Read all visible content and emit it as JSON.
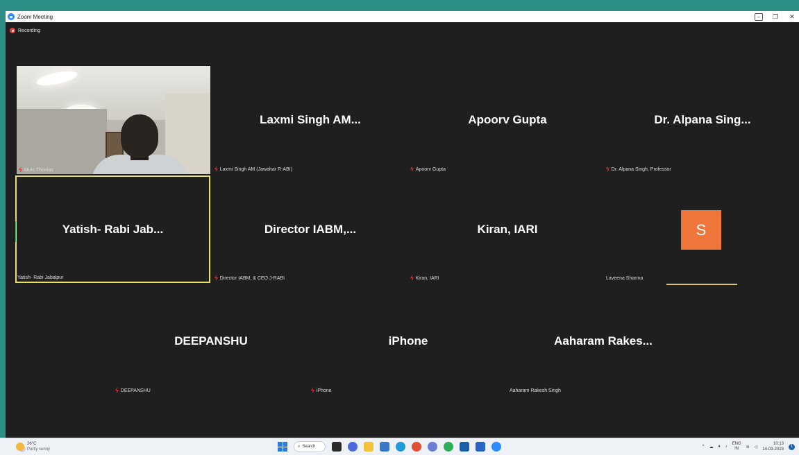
{
  "window": {
    "title": "Zoom Meeting",
    "controls": {
      "minimize": "–",
      "restore": "❐",
      "close": "✕"
    }
  },
  "recording": {
    "label": "Recording",
    "icon": "record-icon",
    "color": "#e0413b"
  },
  "tiles": [
    {
      "id": "moni",
      "label": "Moni Thomas",
      "muted": true,
      "video": true
    },
    {
      "id": "laxmi",
      "display_name": "Laxmi Singh AM...",
      "label": "Laxmi Singh AM (Jawahar R-ABI)",
      "muted": true
    },
    {
      "id": "apoorv",
      "display_name": "Apoorv Gupta",
      "label": "Apoorv Gupta",
      "muted": true
    },
    {
      "id": "alpana",
      "display_name": "Dr. Alpana Sing...",
      "label": "Dr. Alpana Singh, Professor",
      "muted": true
    },
    {
      "id": "yatish",
      "display_name": "Yatish- Rabi Jab...",
      "label": "Yatish- Rabi Jabalpur",
      "muted": false,
      "active_speaker": true
    },
    {
      "id": "director",
      "display_name": "Director IABM,...",
      "label": "Director IABM, & CEO J-RABI",
      "muted": true
    },
    {
      "id": "kiran",
      "display_name": "Kiran, IARI",
      "label": "Kiran, IARI",
      "muted": true
    },
    {
      "id": "laveena",
      "avatar_letter": "S",
      "label": "Laveena Sharma",
      "muted": false,
      "avatar_color": "#f0753a"
    },
    {
      "id": "deepanshu",
      "display_name": "DEEPANSHU",
      "label": "DEEPANSHU",
      "muted": true
    },
    {
      "id": "iphone",
      "display_name": "iPhone",
      "label": "iPhone",
      "muted": true
    },
    {
      "id": "aaharam",
      "display_name": "Aaharam Rakes...",
      "label": "Aaharam Rakesh Singh",
      "muted": false
    }
  ],
  "colors": {
    "active_speaker_border": "#e8e067",
    "mic_muted": "#e3332d",
    "meeting_bg": "#1f1f1f"
  },
  "taskbar": {
    "weather": {
      "temp": "26°C",
      "condition": "Partly sunny"
    },
    "search_label": "Search",
    "lang": {
      "top": "ENG",
      "bottom": "IN"
    },
    "time": "10:13",
    "date": "14-03-2023"
  }
}
